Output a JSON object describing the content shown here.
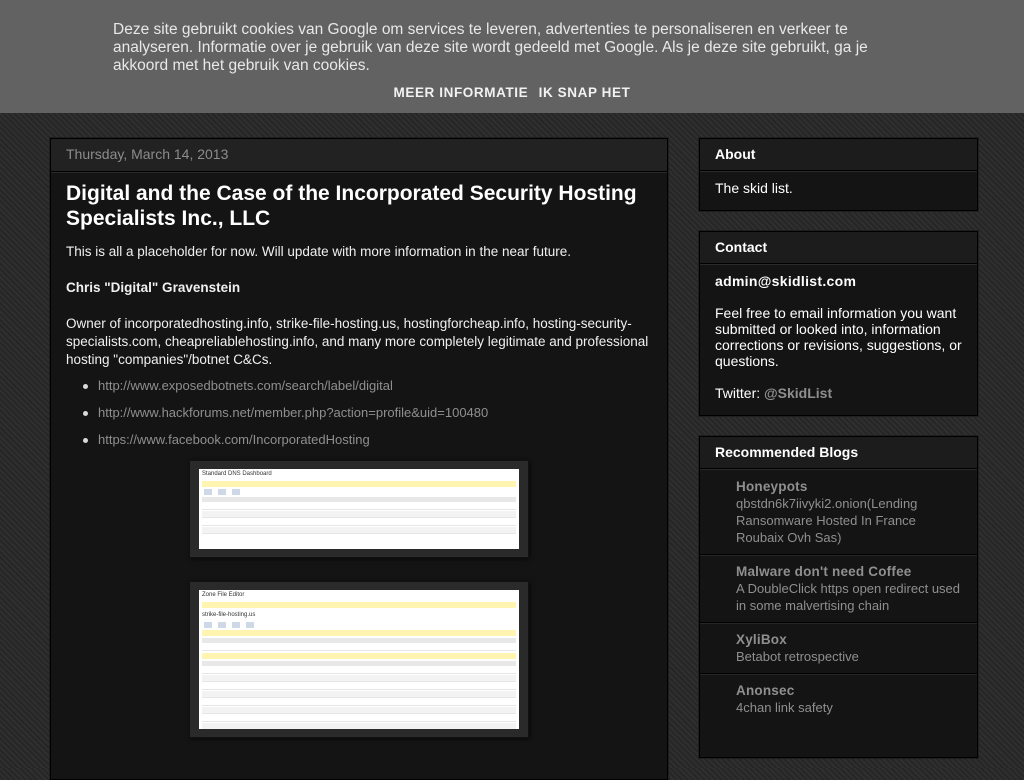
{
  "cookie_bar": {
    "text": "Deze site gebruikt cookies van Google om services te leveren, advertenties te personaliseren en verkeer te analyseren. Informatie over je gebruik van deze site wordt gedeeld met Google. Als je deze site gebruikt, ga je akkoord met het gebruik van cookies.",
    "more_info": "MEER INFORMATIE",
    "accept": "IK SNAP HET"
  },
  "post": {
    "date": "Thursday, March 14, 2013",
    "title": "Digital and the Case of the Incorporated Security Hosting Specialists Inc., LLC",
    "intro": "This is all a placeholder for now. Will update with more information in the near future.",
    "person": "Chris \"Digital\" Gravenstein",
    "description": "Owner of incorporatedhosting.info, strike-file-hosting.us, hostingforcheap.info, hosting-security-specialists.com, cheapreliablehosting.info, and many more completely legitimate and professional hosting \"companies\"/botnet C&Cs.",
    "links": [
      "http://www.exposedbotnets.com/search/label/digital",
      "http://www.hackforums.net/member.php?action=profile&uid=100480",
      "https://www.facebook.com/IncorporatedHosting"
    ],
    "screenshot1_title": "Standard DNS Dashboard",
    "screenshot2_title": "Zone File Editor",
    "screenshot2_domain": "strike-file-hosting.us"
  },
  "sidebar": {
    "about": {
      "title": "About",
      "text": "The skid list."
    },
    "contact": {
      "title": "Contact",
      "email": "admin@skidlist.com",
      "text": "Feel free to email information you want submitted or looked into, information corrections or revisions, suggestions, or questions.",
      "twitter_label": "Twitter: ",
      "twitter_handle": "@SkidList"
    },
    "blogs": {
      "title": "Recommended Blogs",
      "items": [
        {
          "name": "Honeypots",
          "post": "qbstdn6k7iivyki2.onion(Lending Ransomware Hosted In France Roubaix Ovh Sas)"
        },
        {
          "name": "Malware don't need Coffee",
          "post": "A DoubleClick https open redirect used in some malvertising chain"
        },
        {
          "name": "XyliBox",
          "post": "Betabot retrospective"
        },
        {
          "name": "Anonsec",
          "post": "4chan link safety"
        }
      ]
    }
  },
  "colors": {
    "background": "#2b2b2b",
    "panel": "#141414",
    "link": "#8f8f8f",
    "cookie_bar": "#626262"
  }
}
